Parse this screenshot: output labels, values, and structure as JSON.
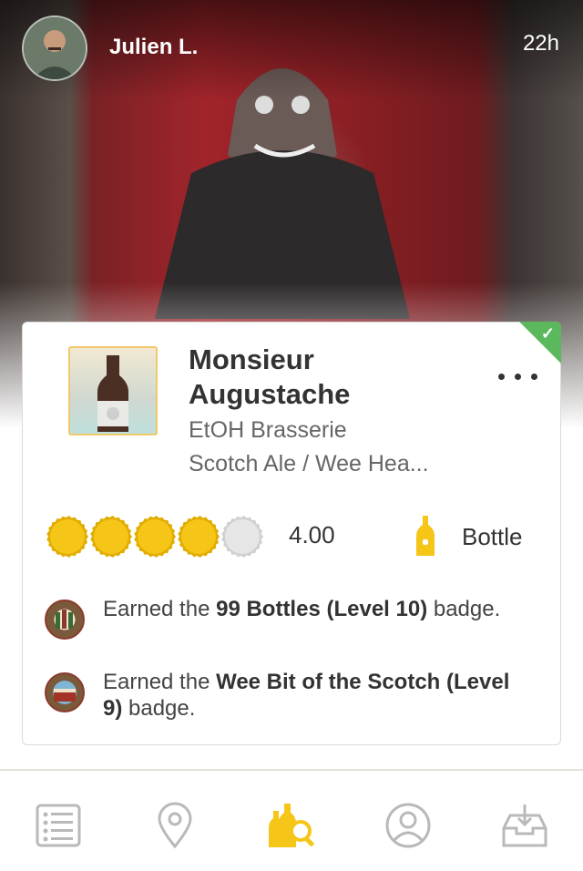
{
  "post": {
    "username": "Julien L.",
    "time_ago": "22h"
  },
  "checkin": {
    "beer_name": "Monsieur Augustache",
    "brewery": "EtOH Brasserie",
    "style": "Scotch Ale / Wee Hea...",
    "rating_value": "4.00",
    "rating_caps_filled": 4,
    "rating_caps_total": 5,
    "serving": "Bottle",
    "verified_icon": "check-icon",
    "menu_icon": "more-dots-icon"
  },
  "badges": [
    {
      "prefix": "Earned the ",
      "name": "99 Bottles (Level 10)",
      "suffix": " badge."
    },
    {
      "prefix": "Earned the ",
      "name": "Wee Bit of the Scotch (Level 9)",
      "suffix": " badge."
    }
  ],
  "tabbar": {
    "items": [
      {
        "name": "activity-tab",
        "icon": "list-icon",
        "active": false
      },
      {
        "name": "nearby-tab",
        "icon": "location-pin-icon",
        "active": false
      },
      {
        "name": "beer-search-tab",
        "icon": "beer-search-icon",
        "active": true
      },
      {
        "name": "profile-tab",
        "icon": "user-icon",
        "active": false
      },
      {
        "name": "inbox-tab",
        "icon": "inbox-icon",
        "active": false
      }
    ]
  },
  "colors": {
    "accent": "#f5c518",
    "verified": "#5cb85c",
    "inactive_icon": "#b9b9b9"
  }
}
